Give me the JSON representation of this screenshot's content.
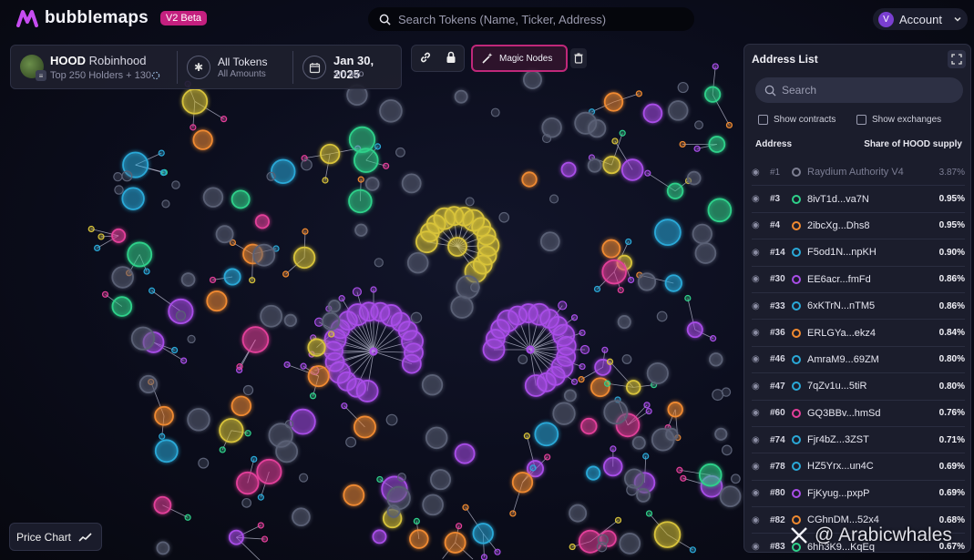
{
  "app": {
    "brand": "bubblemaps",
    "badge": "V2 Beta",
    "search_placeholder": "Search Tokens (Name, Ticker, Address)",
    "account_initial": "V",
    "account_label": "Account"
  },
  "token": {
    "ticker": "HOOD",
    "name": "Robinhood",
    "holders": "Top 250 Holders + 130",
    "filter_title": "All Tokens",
    "filter_sub": "All Amounts",
    "date": "Jan 30, 2025",
    "date_sub": "3m ago"
  },
  "toolbar": {
    "magic_nodes": "Magic Nodes"
  },
  "address_list": {
    "title": "Address List",
    "search_placeholder": "Search",
    "show_contracts": "Show contracts",
    "show_exchanges": "Show exchanges",
    "col_address": "Address",
    "col_share": "Share of HOOD supply",
    "rows": [
      {
        "rank": "#1",
        "addr": "Raydium Authority V4",
        "pct": "3.87%",
        "color": "#7d7f92",
        "dim": true
      },
      {
        "rank": "#3",
        "addr": "8ivT1d...va7N",
        "pct": "0.95%",
        "color": "#2fd18a"
      },
      {
        "rank": "#4",
        "addr": "2ibcXg...Dhs8",
        "pct": "0.95%",
        "color": "#f08a30"
      },
      {
        "rank": "#14",
        "addr": "F5od1N...npKH",
        "pct": "0.90%",
        "color": "#2aa9d8"
      },
      {
        "rank": "#30",
        "addr": "EE6acr...fmFd",
        "pct": "0.86%",
        "color": "#a94ee8"
      },
      {
        "rank": "#33",
        "addr": "6xKTrN...nTM5",
        "pct": "0.86%",
        "color": "#2aa9d8"
      },
      {
        "rank": "#36",
        "addr": "ERLGYa...ekz4",
        "pct": "0.84%",
        "color": "#f08a30"
      },
      {
        "rank": "#46",
        "addr": "AmraM9...69ZM",
        "pct": "0.80%",
        "color": "#2aa9d8"
      },
      {
        "rank": "#47",
        "addr": "7qZv1u...5tiR",
        "pct": "0.80%",
        "color": "#2aa9d8"
      },
      {
        "rank": "#60",
        "addr": "GQ3BBv...hmSd",
        "pct": "0.76%",
        "color": "#e33f9a"
      },
      {
        "rank": "#74",
        "addr": "Fjr4bZ...3ZST",
        "pct": "0.71%",
        "color": "#2aa9d8"
      },
      {
        "rank": "#78",
        "addr": "HZ5Yrx...un4C",
        "pct": "0.69%",
        "color": "#2aa9d8"
      },
      {
        "rank": "#80",
        "addr": "FjKyug...pxpP",
        "pct": "0.69%",
        "color": "#a94ee8"
      },
      {
        "rank": "#82",
        "addr": "CGhnDM...52x4",
        "pct": "0.68%",
        "color": "#f08a30"
      },
      {
        "rank": "#83",
        "addr": "6hh3K9...KqEq",
        "pct": "0.67%",
        "color": "#2fd18a"
      }
    ]
  },
  "price_chart_label": "Price Chart",
  "watermark": "@ Arabicwhales",
  "colors": {
    "accent": "#c4207f",
    "bubble_yellow": "#d8c33a",
    "bubble_purple": "#a94ee8",
    "bubble_green": "#2fd18a",
    "bubble_cyan": "#2aa9d8",
    "bubble_pink": "#e33f9a",
    "bubble_orange": "#f08a30",
    "bubble_gray": "#5a6075"
  }
}
